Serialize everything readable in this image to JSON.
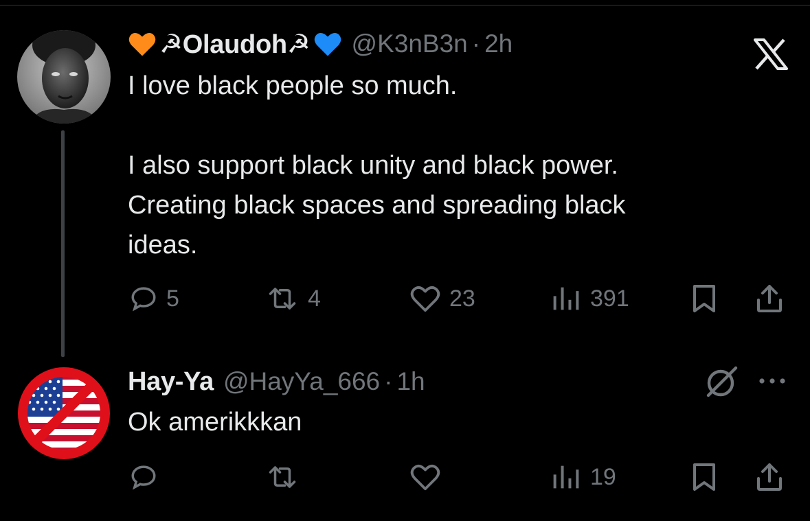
{
  "post": {
    "display_name": "☭Olaudoh☭",
    "handle": "@K3nB3n",
    "separator": "·",
    "time": "2h",
    "text": "I love black people so much.\n\nI also support black unity and black power.\nCreating black spaces and spreading black\nideas.",
    "stats": {
      "replies": "5",
      "reposts": "4",
      "likes": "23",
      "views": "391"
    }
  },
  "reply": {
    "display_name": "Hay-Ya",
    "handle": "@HayYa_666",
    "separator": "·",
    "time": "1h",
    "text": "Ok amerikkkan",
    "stats": {
      "views": "19"
    }
  },
  "colors": {
    "background": "#000000",
    "primary_text": "#e7e9ea",
    "secondary_text": "#71767b",
    "orange_heart": "#ff8c1a",
    "blue_heart": "#1d8cf8",
    "prohibition_red": "#e0101a"
  },
  "icons": {
    "app_logo": "x-logo-icon",
    "reply": "comment-icon",
    "repost": "repost-icon",
    "like": "heart-icon",
    "views": "bar-chart-icon",
    "bookmark": "bookmark-icon",
    "share": "share-icon",
    "grok": "grok-icon",
    "more": "more-icon"
  }
}
